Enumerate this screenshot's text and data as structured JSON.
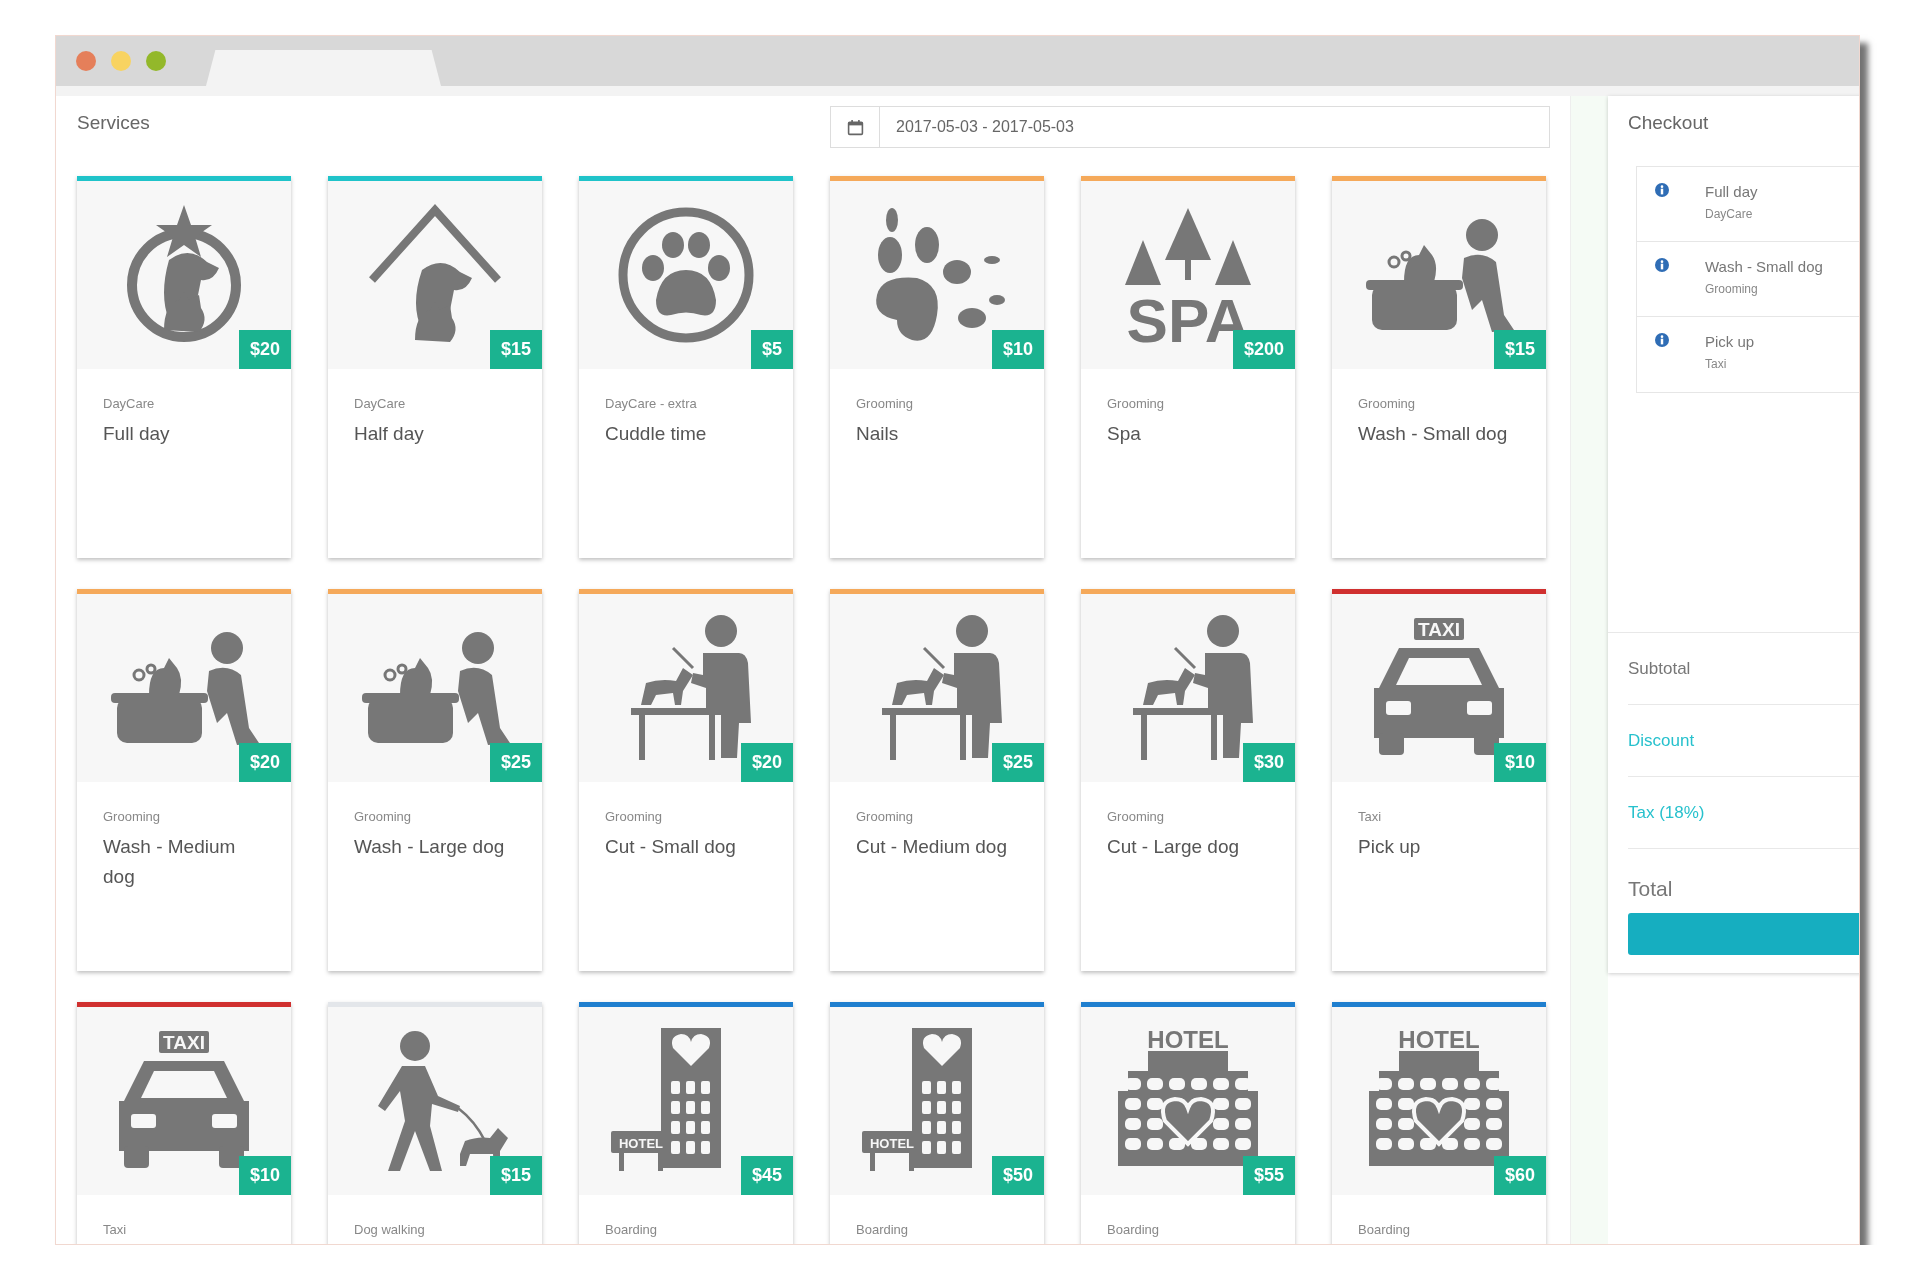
{
  "services_panel": {
    "title": "Services",
    "date_range": "2017-05-03 - 2017-05-03"
  },
  "services": [
    {
      "category": "DayCare",
      "name": "Full day",
      "price": "$20",
      "color": "#1fc3c9"
    },
    {
      "category": "DayCare",
      "name": "Half day",
      "price": "$15",
      "color": "#1fc3c9"
    },
    {
      "category": "DayCare - extra",
      "name": "Cuddle time",
      "price": "$5",
      "color": "#1fc3c9"
    },
    {
      "category": "Grooming",
      "name": "Nails",
      "price": "$10",
      "color": "#f5a95a"
    },
    {
      "category": "Grooming",
      "name": "Spa",
      "price": "$200",
      "color": "#f5a95a",
      "icon_text": "SPA"
    },
    {
      "category": "Grooming",
      "name": "Wash - Small dog",
      "price": "$15",
      "color": "#f5a95a"
    },
    {
      "category": "Grooming",
      "name": "Wash - Medium dog",
      "price": "$20",
      "color": "#f5a95a"
    },
    {
      "category": "Grooming",
      "name": "Wash - Large dog",
      "price": "$25",
      "color": "#f5a95a"
    },
    {
      "category": "Grooming",
      "name": "Cut - Small dog",
      "price": "$20",
      "color": "#f5a95a"
    },
    {
      "category": "Grooming",
      "name": "Cut - Medium dog",
      "price": "$25",
      "color": "#f5a95a"
    },
    {
      "category": "Grooming",
      "name": "Cut - Large dog",
      "price": "$30",
      "color": "#f5a95a"
    },
    {
      "category": "Taxi",
      "name": "Pick up",
      "price": "$10",
      "color": "#d0302f",
      "icon_text": "TAXI"
    },
    {
      "category": "Taxi",
      "price": "$10",
      "color": "#d0302f",
      "icon_text": "TAXI"
    },
    {
      "category": "Dog walking",
      "price": "$15",
      "color": "#e3e6ea"
    },
    {
      "category": "Boarding",
      "price": "$45",
      "color": "#1f7fcf",
      "icon_text": "HOTEL"
    },
    {
      "category": "Boarding",
      "price": "$50",
      "color": "#1f7fcf",
      "icon_text": "HOTEL"
    },
    {
      "category": "Boarding",
      "price": "$55",
      "color": "#1f7fcf",
      "icon_text": "HOTEL"
    },
    {
      "category": "Boarding",
      "price": "$60",
      "color": "#1f7fcf",
      "icon_text": "HOTEL"
    }
  ],
  "checkout": {
    "title": "Checkout",
    "items": [
      {
        "name": "Full day",
        "category": "DayCare"
      },
      {
        "name": "Wash - Small dog",
        "category": "Grooming"
      },
      {
        "name": "Pick up",
        "category": "Taxi"
      }
    ],
    "summary": [
      {
        "label": "Subtotal",
        "kind": "plain"
      },
      {
        "label": "Discount",
        "kind": "link"
      },
      {
        "label": "Tax (18%)",
        "kind": "link"
      },
      {
        "label": "Total",
        "kind": "total"
      }
    ]
  }
}
